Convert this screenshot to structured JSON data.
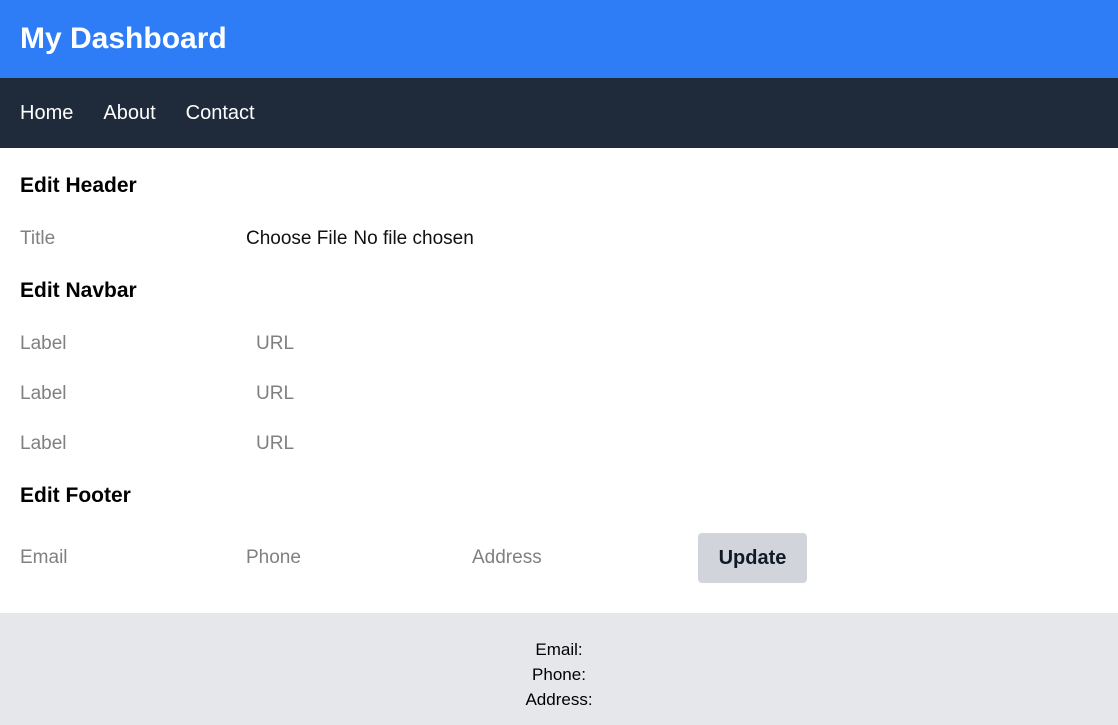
{
  "header": {
    "title": "My Dashboard"
  },
  "navbar": {
    "items": [
      {
        "label": "Home"
      },
      {
        "label": "About"
      },
      {
        "label": "Contact"
      }
    ]
  },
  "edit_header": {
    "title": "Edit Header",
    "title_placeholder": "Title",
    "file_button": "Choose File",
    "file_status": "No file chosen"
  },
  "edit_navbar": {
    "title": "Edit Navbar",
    "rows": [
      {
        "label_placeholder": "Label",
        "url_placeholder": "URL"
      },
      {
        "label_placeholder": "Label",
        "url_placeholder": "URL"
      },
      {
        "label_placeholder": "Label",
        "url_placeholder": "URL"
      }
    ]
  },
  "edit_footer": {
    "title": "Edit Footer",
    "email_placeholder": "Email",
    "phone_placeholder": "Phone",
    "address_placeholder": "Address",
    "update_label": "Update"
  },
  "footer": {
    "email": "Email:",
    "phone": "Phone:",
    "address": "Address:"
  },
  "colors": {
    "header_bg": "#2e7df7",
    "navbar_bg": "#1f2a3b",
    "footer_bg": "#e5e7eb",
    "button_bg": "#d1d5db"
  }
}
